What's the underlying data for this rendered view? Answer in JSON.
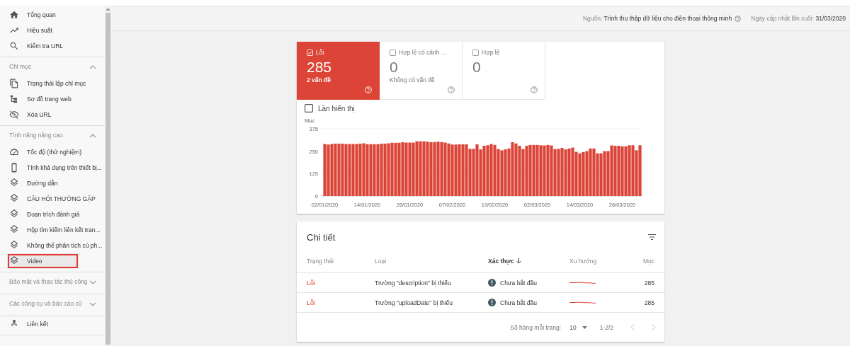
{
  "header": {
    "source_label": "Nguồn:",
    "source_value": "Trình thu thập dữ liệu cho điện thoại thông minh",
    "updated_label": "Ngày cập nhật lần cuối:",
    "updated_value": "31/03/2020"
  },
  "sidebar": {
    "sections": [
      {
        "items": [
          {
            "label": "Tổng quan",
            "selected": false
          },
          {
            "label": "Hiệu suất",
            "selected": false
          },
          {
            "label": "Kiểm tra URL",
            "selected": false
          }
        ]
      },
      {
        "title": "Chỉ mục",
        "expanded": true,
        "items": [
          {
            "label": "Trạng thái lập chỉ mục",
            "selected": false
          },
          {
            "label": "Sơ đồ trang web",
            "selected": false
          },
          {
            "label": "Xóa URL",
            "selected": false
          }
        ]
      },
      {
        "title": "Tính năng nâng cao",
        "expanded": true,
        "items": [
          {
            "label": "Tốc độ (thử nghiệm)",
            "selected": false
          },
          {
            "label": "Tính khả dụng trên thiết bị...",
            "selected": false
          },
          {
            "label": "Đường dẫn",
            "selected": false
          },
          {
            "label": "CÂU HỎI THƯỜNG GẶP",
            "selected": false
          },
          {
            "label": "Đoạn trích đánh giá",
            "selected": false
          },
          {
            "label": "Hộp tìm kiếm liên kết tran...",
            "selected": false
          },
          {
            "label": "Không thể phân tích cú ph...",
            "selected": false
          },
          {
            "label": "Video",
            "selected": true
          }
        ]
      },
      {
        "title": "Bảo mật và thao tác thủ công",
        "expanded": false
      },
      {
        "title": "Các công cụ và báo cáo cũ",
        "expanded": false
      },
      {
        "items": [
          {
            "label": "Liên kết",
            "selected": false
          }
        ]
      }
    ]
  },
  "status_cards": [
    {
      "label": "Lỗi",
      "value": "285",
      "subtitle": "2 vấn đề",
      "selected": true,
      "checked": true
    },
    {
      "label": "Hợp lệ có cảnh ...",
      "value": "0",
      "subtitle": "Không có vấn đề",
      "selected": false,
      "checked": false
    },
    {
      "label": "Hợp lệ",
      "value": "0",
      "selected": false,
      "checked": false
    }
  ],
  "impressions_checkbox": {
    "label": "Lần hiển thị",
    "checked": false
  },
  "chart_data": {
    "type": "bar",
    "ylabel": "Mục",
    "ylim": [
      0,
      375
    ],
    "yticks": [
      0,
      125,
      250,
      375
    ],
    "categories": [
      "02/01/2020",
      null,
      null,
      null,
      null,
      null,
      null,
      null,
      null,
      null,
      null,
      null,
      "14/01/2020",
      null,
      null,
      null,
      null,
      null,
      null,
      null,
      null,
      null,
      null,
      null,
      "26/01/2020",
      null,
      null,
      null,
      null,
      null,
      null,
      null,
      null,
      null,
      null,
      null,
      "07/02/2020",
      null,
      null,
      null,
      null,
      null,
      null,
      null,
      null,
      null,
      null,
      null,
      "19/02/2020",
      null,
      null,
      null,
      null,
      null,
      null,
      null,
      null,
      null,
      null,
      null,
      "02/03/2020",
      null,
      null,
      null,
      null,
      null,
      null,
      null,
      null,
      null,
      null,
      null,
      "14/03/2020",
      null,
      null,
      null,
      null,
      null,
      null,
      null,
      null,
      null,
      null,
      null,
      "26/03/2020",
      null,
      null,
      null,
      null,
      null
    ],
    "series": [
      {
        "color": "#db4437",
        "values": [
          290,
          287,
          290,
          292,
          292,
          292,
          290,
          290,
          290,
          290,
          292,
          294,
          289,
          289,
          289,
          289,
          292,
          292,
          294,
          297,
          297,
          297,
          300,
          298,
          298,
          298,
          305,
          305,
          305,
          303,
          300,
          301,
          303,
          301,
          298,
          293,
          287,
          287,
          288,
          288,
          288,
          263,
          263,
          288,
          260,
          280,
          283,
          290,
          285,
          262,
          255,
          260,
          265,
          300,
          293,
          280,
          262,
          280,
          285,
          285,
          285,
          283,
          282,
          285,
          282,
          262,
          263,
          268,
          260,
          265,
          270,
          246,
          238,
          245,
          250,
          265,
          265,
          238,
          238,
          250,
          250,
          282,
          280,
          280,
          277,
          277,
          283,
          283,
          255,
          283
        ]
      }
    ]
  },
  "details": {
    "title": "Chi tiết",
    "columns": [
      {
        "label": "Trạng thái",
        "sorted": false
      },
      {
        "label": "Loại",
        "sorted": false
      },
      {
        "label": "Xác thực",
        "sorted": true
      },
      {
        "label": "Xu hướng",
        "sorted": false
      },
      {
        "label": "Mục",
        "sorted": false
      }
    ],
    "rows": [
      {
        "status": "Lỗi",
        "type": "Trường \"description\" bị thiếu",
        "validation": "Chưa bắt đầu",
        "items": "285"
      },
      {
        "status": "Lỗi",
        "type": "Trường \"uploadDate\" bị thiếu",
        "validation": "Chưa bắt đầu",
        "items": "285"
      }
    ],
    "rows_per_page_label": "Số hàng mỗi trang:",
    "rows_per_page": "10",
    "range": "1-2/2"
  }
}
